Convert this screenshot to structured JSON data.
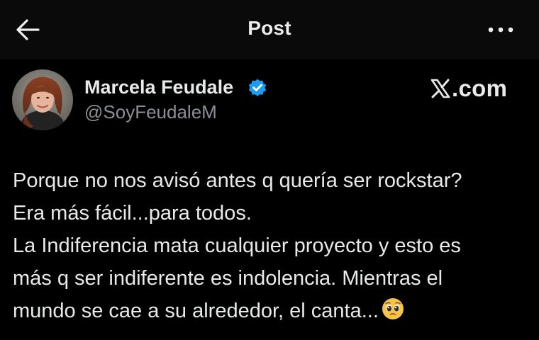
{
  "header": {
    "title": "Post",
    "back_icon": "arrow-left-icon",
    "more_icon": "more-horizontal-icon"
  },
  "author": {
    "name": "Marcela Feudale",
    "handle": "@SoyFeudaleM",
    "verified": true,
    "verified_color": "#1d9bf0"
  },
  "brand": {
    "logo_icon": "x-logo-icon",
    "text": ".com"
  },
  "post": {
    "lines": [
      "Porque no nos avisó antes q quería ser rockstar?",
      "Era más fácil...para todos.",
      "La Indiferencia mata cualquier proyecto y esto es",
      "más q ser indiferente es indolencia. Mientras el",
      "mundo se cae a su alrededor, el canta..."
    ],
    "trailing_emoji": "pleading-face-emoji"
  },
  "colors": {
    "background": "#000000",
    "text": "#e7e9ea",
    "muted": "#8b8f94",
    "accent": "#1d9bf0"
  }
}
